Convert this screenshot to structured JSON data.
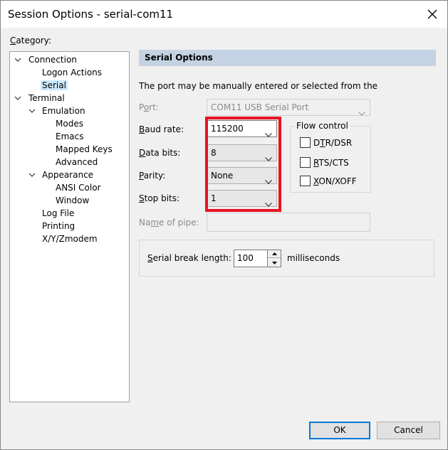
{
  "window": {
    "title": "Session Options - serial-com11"
  },
  "category": {
    "label": "Category:",
    "tree": [
      {
        "label": "Connection",
        "expanded": true
      },
      {
        "label": "Logon Actions"
      },
      {
        "label": "Serial",
        "selected": true
      },
      {
        "label": "Terminal",
        "expanded": true
      },
      {
        "label": "Emulation",
        "expanded": true
      },
      {
        "label": "Modes"
      },
      {
        "label": "Emacs"
      },
      {
        "label": "Mapped Keys"
      },
      {
        "label": "Advanced"
      },
      {
        "label": "Appearance",
        "expanded": true
      },
      {
        "label": "ANSI Color"
      },
      {
        "label": "Window"
      },
      {
        "label": "Log File"
      },
      {
        "label": "Printing"
      },
      {
        "label": "X/Y/Zmodem"
      }
    ]
  },
  "serial": {
    "header": "Serial Options",
    "description": "The port may be manually entered or selected from the",
    "port": {
      "label_pre": "P",
      "label_key": "o",
      "label_post": "rt:",
      "value": "COM11 USB Serial Port",
      "enabled": false
    },
    "baud": {
      "label_key": "B",
      "label_post": "aud rate:",
      "value": "115200"
    },
    "data_bits": {
      "label_key": "D",
      "label_post": "ata bits:",
      "value": "8"
    },
    "parity": {
      "label_key": "P",
      "label_post": "arity:",
      "value": "None"
    },
    "stop_bits": {
      "label_key": "S",
      "label_post": "top bits:",
      "value": "1"
    },
    "flow_control": {
      "title": "Flow control",
      "dtr": {
        "pre": "D",
        "key": "T",
        "post": "R/DSR",
        "checked": false
      },
      "rts": {
        "pre": "",
        "key": "R",
        "post": "TS/CTS",
        "checked": false
      },
      "xon": {
        "pre": "",
        "key": "X",
        "post": "ON/XOFF",
        "checked": false
      }
    },
    "pipe": {
      "pre": "Na",
      "key": "m",
      "post": "e of pipe:",
      "enabled": false
    },
    "break": {
      "key": "S",
      "post": "erial break length:",
      "value": "100",
      "unit": "milliseconds"
    }
  },
  "buttons": {
    "ok": "OK",
    "cancel": "Cancel"
  }
}
